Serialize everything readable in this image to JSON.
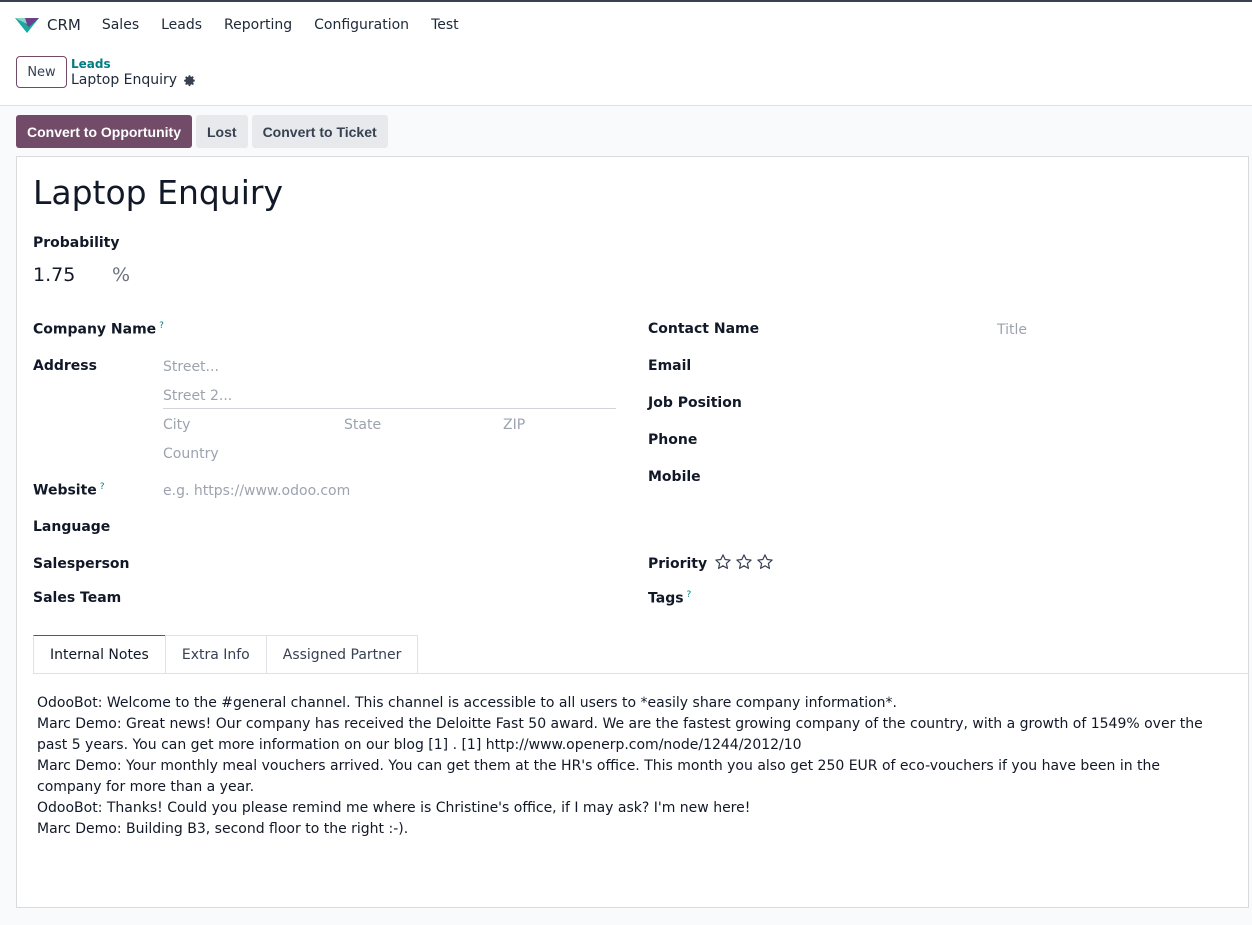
{
  "nav": {
    "brand": "CRM",
    "items": [
      "Sales",
      "Leads",
      "Reporting",
      "Configuration",
      "Test"
    ]
  },
  "control_panel": {
    "new_label": "New",
    "breadcrumb_parent": "Leads",
    "breadcrumb_current": "Laptop Enquiry"
  },
  "statusbar": {
    "convert_opportunity": "Convert to Opportunity",
    "lost": "Lost",
    "convert_ticket": "Convert to Ticket"
  },
  "form": {
    "title": "Laptop Enquiry",
    "probability_label": "Probability",
    "probability_value": "1.75",
    "probability_unit": "%",
    "company_name_label": "Company Name",
    "address_label": "Address",
    "street_placeholder": "Street...",
    "street2_placeholder": "Street 2...",
    "city_placeholder": "City",
    "state_placeholder": "State",
    "zip_placeholder": "ZIP",
    "country_placeholder": "Country",
    "website_label": "Website",
    "website_placeholder": "e.g. https://www.odoo.com",
    "language_label": "Language",
    "salesperson_label": "Salesperson",
    "sales_team_label": "Sales Team",
    "contact_name_label": "Contact Name",
    "title_placeholder": "Title",
    "email_label": "Email",
    "job_position_label": "Job Position",
    "phone_label": "Phone",
    "mobile_label": "Mobile",
    "priority_label": "Priority",
    "priority_stars": 0,
    "priority_max": 3,
    "tags_label": "Tags",
    "help_mark": "?"
  },
  "tabs": [
    "Internal Notes",
    "Extra Info",
    "Assigned Partner"
  ],
  "active_tab": "Internal Notes",
  "notes": [
    "OdooBot: Welcome to the #general channel. This channel is accessible to all users to *easily share company information*.",
    "Marc Demo: Great news! Our company has received the Deloitte Fast 50 award. We are the fastest growing company of the country, with a growth of 1549% over the past 5 years. You can get more information on our blog [1] . [1] http://www.openerp.com/node/1244/2012/10",
    "Marc Demo: Your monthly meal vouchers arrived. You can get them at the HR's office. This month you also get 250 EUR of eco-vouchers if you have been in the company for more than a year.",
    "OdooBot: Thanks! Could you please remind me where is Christine's office, if I may ask? I'm new here!",
    "Marc Demo: Building B3, second floor to the right :-)."
  ],
  "colors": {
    "primary": "#714b67",
    "link": "#017e84"
  }
}
